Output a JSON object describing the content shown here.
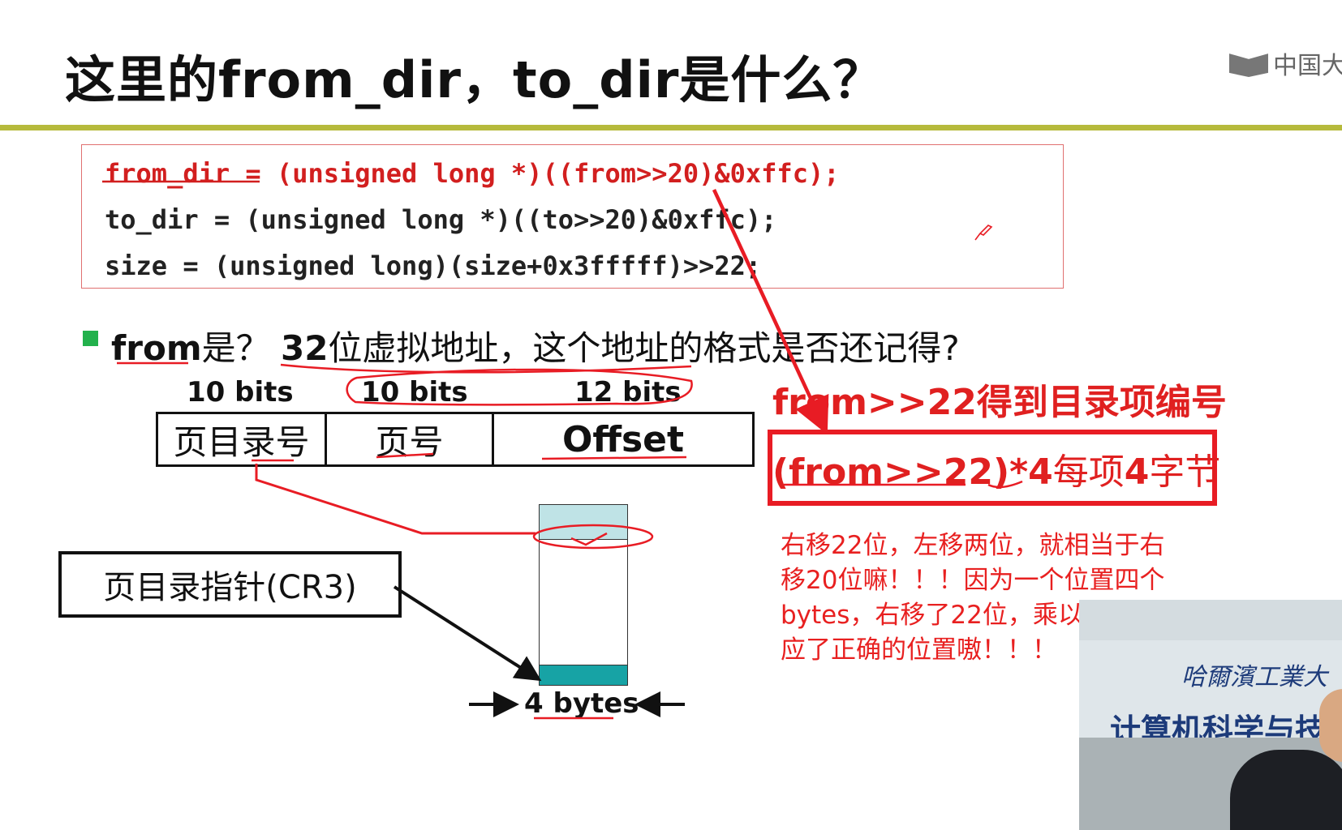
{
  "slide": {
    "title": "这里的from_dir，to_dir是什么？",
    "logo_text": "中国大"
  },
  "code": {
    "line1": "from_dir = (unsigned long *)((from>>20)&0xffc);",
    "line2": "to_dir = (unsigned long *)((to>>20)&0xffc);",
    "line3": "size = (unsigned long)(size+0x3fffff)>>22;"
  },
  "question": {
    "bold_prefix": "from",
    "text1": "是？ ",
    "bold_num": "32",
    "text2": "位虚拟地址，这个地址的格式是否还记得?"
  },
  "address_format": {
    "bit_labels": [
      "10 bits",
      "10 bits",
      "12 bits"
    ],
    "fields": [
      "页目录号",
      "页号",
      "Offset"
    ]
  },
  "cr3_label": "页目录指针(CR3)",
  "entry_size_label": "4 bytes",
  "annotations": {
    "line1": "from>>22得到目录项编号",
    "line2_bold": "(from>>22)*4",
    "line2_text": "每项",
    "line2_num": "4",
    "line2_tail": "字节",
    "note": "右移22位，左移两位，就相当于右移20位嘛！！！因为一个位置四个bytes，右移了22位，乘以4才对应了正确的位置嗷！！！"
  },
  "video": {
    "school": "哈爾濱工業大",
    "dept": "计算机科学与技"
  },
  "colors": {
    "accent_bar": "#b6ba3c",
    "annotation_red": "#e81c24",
    "bullet_green": "#22b14c",
    "table_teal": "#17a3a5"
  }
}
